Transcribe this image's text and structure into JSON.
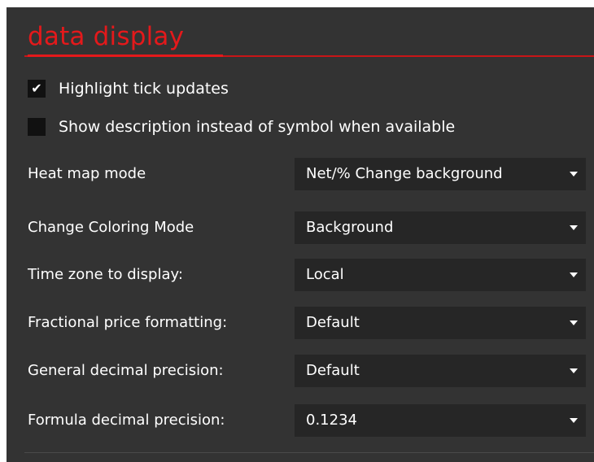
{
  "section": {
    "title": "data display",
    "accent_color": "#e4191b"
  },
  "checkboxes": [
    {
      "label": "Highlight tick updates",
      "checked": true
    },
    {
      "label": "Show description instead of symbol when available",
      "checked": false
    }
  ],
  "settings": [
    {
      "label": "Heat map mode",
      "value": "Net/% Change background"
    },
    {
      "label": "Change Coloring Mode",
      "value": "Background"
    },
    {
      "label": "Time zone to display:",
      "value": "Local"
    },
    {
      "label": "Fractional price formatting:",
      "value": "Default"
    },
    {
      "label": "General decimal precision:",
      "value": "Default"
    },
    {
      "label": "Formula decimal precision:",
      "value": "0.1234"
    }
  ],
  "icons": {
    "check": "check-icon",
    "dropdown": "chevron-down-icon"
  }
}
